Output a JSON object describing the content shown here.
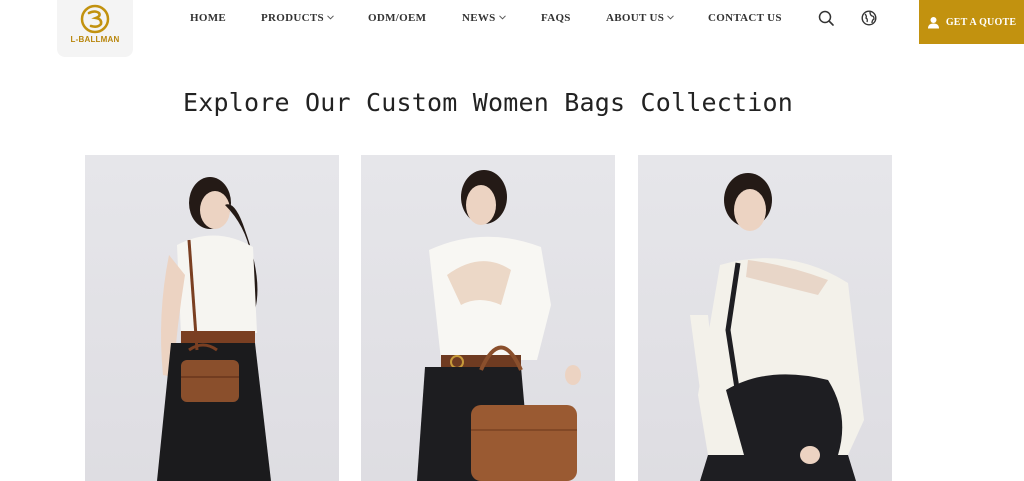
{
  "brand": {
    "logo_text": "L-BALLMAN",
    "accent_color": "#c2920f"
  },
  "nav": {
    "items": [
      {
        "label": "HOME",
        "dropdown": false
      },
      {
        "label": "PRODUCTS",
        "dropdown": true
      },
      {
        "label": "ODM/OEM",
        "dropdown": false
      },
      {
        "label": "NEWS",
        "dropdown": true
      },
      {
        "label": "FAQS",
        "dropdown": false
      },
      {
        "label": "ABOUT US",
        "dropdown": true
      },
      {
        "label": "CONTACT US",
        "dropdown": false
      }
    ],
    "search_icon": "search-icon",
    "language_icon": "globe-icon"
  },
  "cta": {
    "label": "GET A QUOTE",
    "icon": "user-icon"
  },
  "main": {
    "title": "Explore Our Custom Women Bags Collection",
    "products": [
      {
        "bag_color": "#8a4f2c",
        "top_color": "#f7f6f2",
        "skirt_color": "#1b1b1d"
      },
      {
        "bag_color": "#9a5a32",
        "top_color": "#f8f7f3",
        "skirt_color": "#1d1d20"
      },
      {
        "bag_color": "#1e1e22",
        "top_color": "#f3f1ea",
        "skirt_color": "#1e1e22"
      }
    ]
  }
}
